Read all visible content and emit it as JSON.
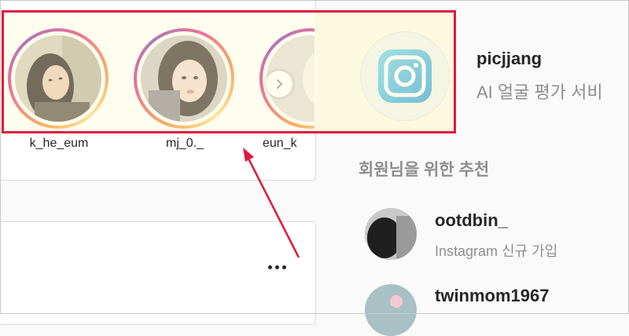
{
  "stories": [
    {
      "username": "k_he_eum"
    },
    {
      "username": "mj_0._"
    },
    {
      "username": "eun_k"
    }
  ],
  "sidebar": {
    "profile": {
      "username": "picjjang",
      "subtitle": "AI 얼굴 평가 서비"
    },
    "recommendations_title": "회원님을 위한 추천",
    "recommendations": [
      {
        "username": "ootdbin_",
        "subtitle": "Instagram 신규 가입"
      },
      {
        "username": "twinmom1967",
        "subtitle": ""
      }
    ]
  },
  "icons": {
    "story_next": "chevron-right-icon",
    "post_more": "more-horizontal-icon",
    "profile_logo": "instagram-camera-icon"
  },
  "colors": {
    "highlight_border": "#e0193f",
    "accent_gradient": [
      "#f58529",
      "#dd2a7b",
      "#8134af",
      "#feda77"
    ],
    "secondary_text": "#8e8e8e"
  }
}
